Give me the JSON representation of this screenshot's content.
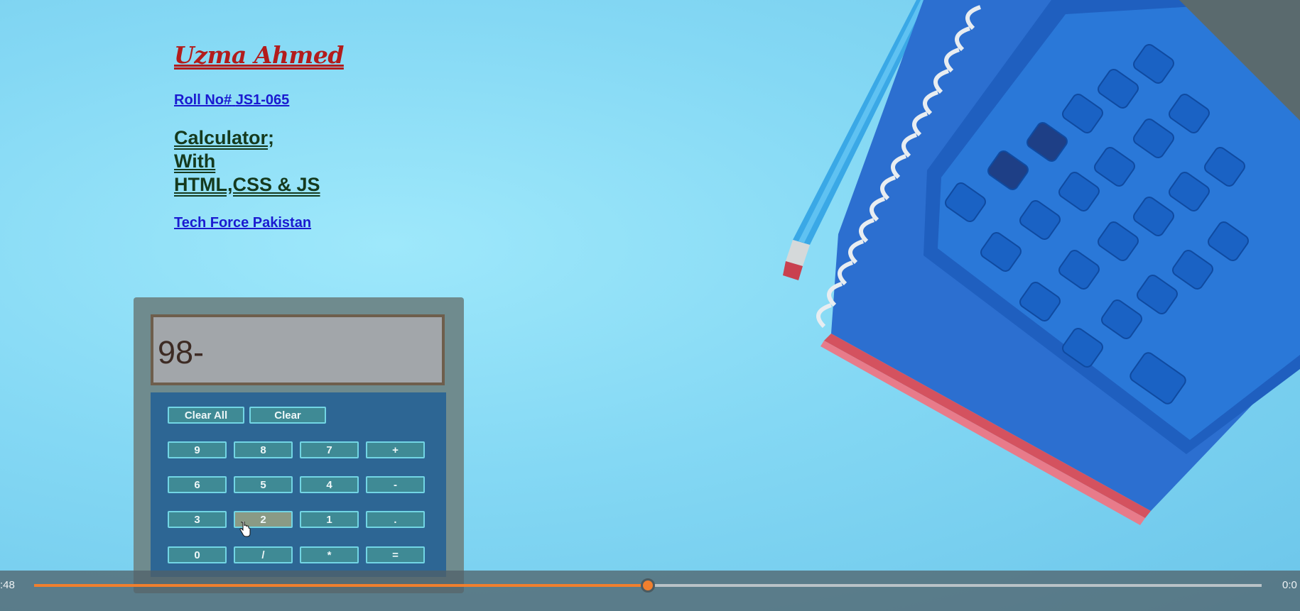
{
  "page": {
    "author": "Uzma Ahmed",
    "roll_label": "Roll No#",
    "roll_number": "JS1-065",
    "title_line1": "Calculator",
    "title_line1_suffix": ";",
    "title_line2": "With",
    "title_line3": "HTML,CSS & JS",
    "organization": "Tech Force Pakistan"
  },
  "calculator": {
    "display_value": "98-",
    "top_buttons": [
      "Clear All",
      "Clear"
    ],
    "rows": [
      [
        "9",
        "8",
        "7",
        "+"
      ],
      [
        "6",
        "5",
        "4",
        "-"
      ],
      [
        "3",
        "2",
        "1",
        "."
      ],
      [
        "0",
        "/",
        "*",
        "="
      ]
    ],
    "hovered_key": "2"
  },
  "video": {
    "elapsed": ":48",
    "remaining": "0:0",
    "progress": 0.5
  },
  "colors": {
    "author": "#b21c1c",
    "link": "#1a1ad0",
    "title": "#153a1e",
    "progress": "#f07f2e"
  },
  "icons": [
    "hand-pointer-cursor-icon"
  ]
}
